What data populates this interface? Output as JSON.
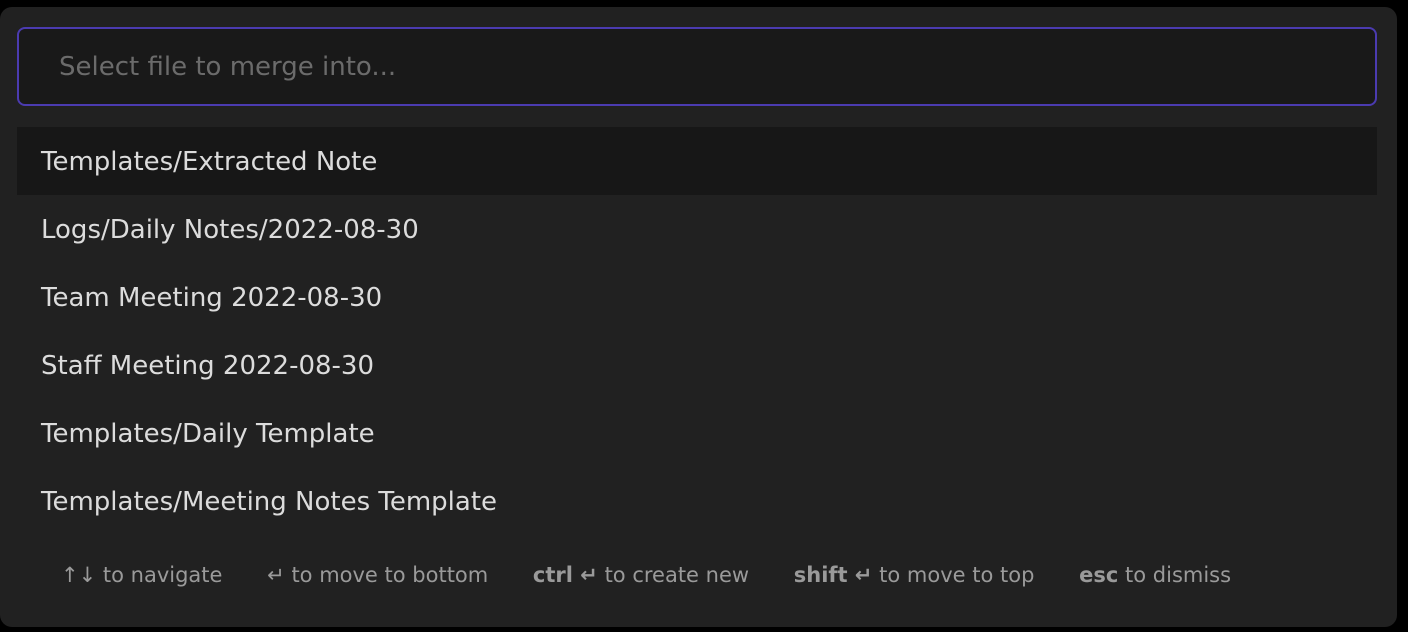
{
  "search": {
    "placeholder": "Select file to merge into...",
    "value": ""
  },
  "results": [
    {
      "label": "Templates/Extracted Note",
      "selected": true
    },
    {
      "label": "Logs/Daily Notes/2022-08-30"
    },
    {
      "label": "Team Meeting 2022-08-30"
    },
    {
      "label": "Staff Meeting 2022-08-30"
    },
    {
      "label": "Templates/Daily Template"
    },
    {
      "label": "Templates/Meeting Notes Template"
    }
  ],
  "instructions": [
    {
      "key": "↑↓",
      "text": "to navigate"
    },
    {
      "key": "↵",
      "text": "to move to bottom"
    },
    {
      "key": "ctrl ↵",
      "text": "to create new"
    },
    {
      "key": "shift ↵",
      "text": "to move to top"
    },
    {
      "key": "esc",
      "text": "to dismiss"
    }
  ],
  "colors": {
    "accent": "#4b3bb0",
    "modal_bg": "#212121",
    "selected_bg": "#171717"
  }
}
